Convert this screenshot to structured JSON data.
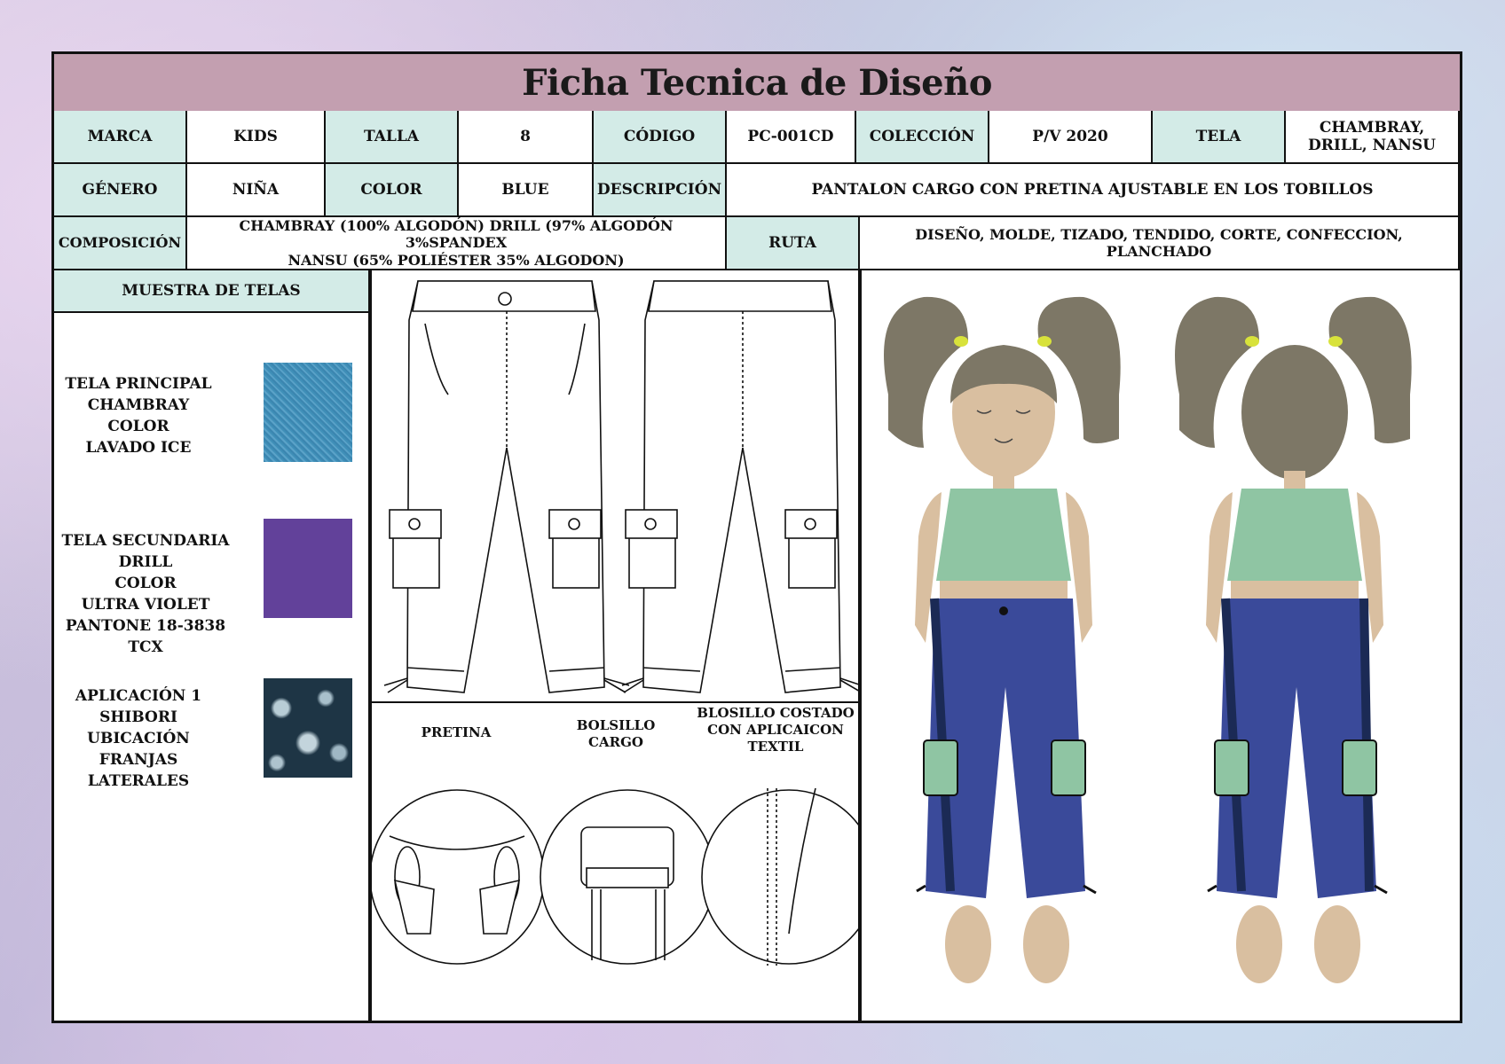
{
  "title": "Ficha Tecnica de Diseño",
  "row1": {
    "marca_label": "MARCA",
    "marca": "KIDS",
    "talla_label": "TALLA",
    "talla": "8",
    "codigo_label": "CÓDIGO",
    "codigo": "PC-001CD",
    "coleccion_label": "COLECCIÓN",
    "coleccion": "P/V  2020",
    "tela_label": "TELA",
    "tela": "CHAMBRAY, DRILL, NANSU"
  },
  "row2": {
    "genero_label": "GÉNERO",
    "genero": "NIÑA",
    "color_label": "COLOR",
    "color": "BLUE",
    "descripcion_label": "DESCRIPCIÓN",
    "descripcion": "PANTALON CARGO CON PRETINA AJUSTABLE EN LOS TOBILLOS"
  },
  "row3": {
    "composicion_label": "COMPOSICIÓN",
    "composicion_line1": "CHAMBRAY (100% ALGODÓN) DRILL (97% ALGODÓN 3%SPANDEX",
    "composicion_line2": "NANSU (65% POLIÉSTER 35% ALGODON)",
    "ruta_label": "RUTA",
    "ruta": "DISEÑO, MOLDE, TIZADO, TENDIDO, CORTE, CONFECCION, PLANCHADO"
  },
  "fabrics": {
    "header": "MUESTRA DE TELAS",
    "items": [
      {
        "lines": [
          "TELA PRINCIPAL",
          "CHAMBRAY",
          "COLOR",
          "LAVADO ICE"
        ],
        "swatch_color": "#3f8fb8"
      },
      {
        "lines": [
          "TELA SECUNDARIA",
          "DRILL",
          "COLOR",
          "ULTRA VIOLET",
          "PANTONE 18-3838 TCX"
        ],
        "swatch_color": "#62419a"
      },
      {
        "lines": [
          "APLICACIÓN 1",
          "SHIBORI",
          "UBICACIÓN",
          "FRANJAS",
          "LATERALES"
        ],
        "swatch_color": "#1e3545"
      }
    ]
  },
  "details": {
    "pretina": "PRETINA",
    "bolsillo_l1": "BOLSILLO",
    "bolsillo_l2": "CARGO",
    "costado_l1": "BLOSILLO COSTADO",
    "costado_l2": "CON APLICAICON",
    "costado_l3": "TEXTIL"
  },
  "colors": {
    "title_bar": "#c39fb0",
    "label_cells": "#d3ebe7",
    "denim": "#3a4a9a",
    "top": "#8fc5a3",
    "hair": "#7d7766",
    "skin": "#d9bfa0",
    "pocket": "#8fc5a3"
  }
}
